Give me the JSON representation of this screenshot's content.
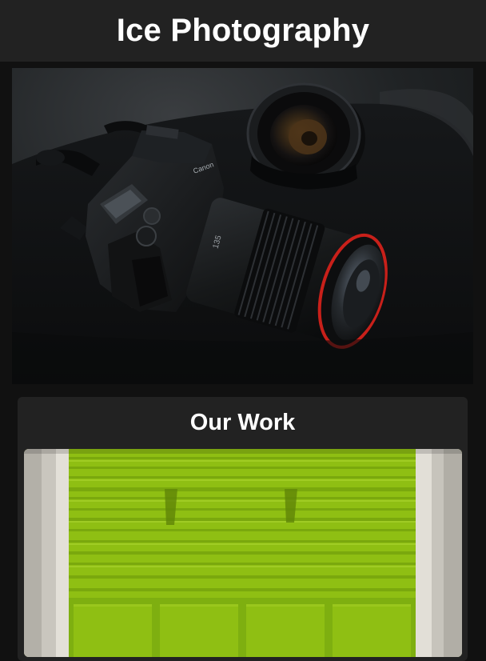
{
  "header": {
    "title": "Ice Photography"
  },
  "hero": {
    "image": "camera-with-lens-photo",
    "camera_brand": "Canon"
  },
  "work": {
    "title": "Our Work",
    "image": "green-garage-door-photo"
  },
  "colors": {
    "page_background": "#111111",
    "header_background": "#222222",
    "card_background": "#222222",
    "title_text": "#ffffff",
    "door_green": "#8fbf13",
    "lens_ring_red": "#c8201a"
  }
}
